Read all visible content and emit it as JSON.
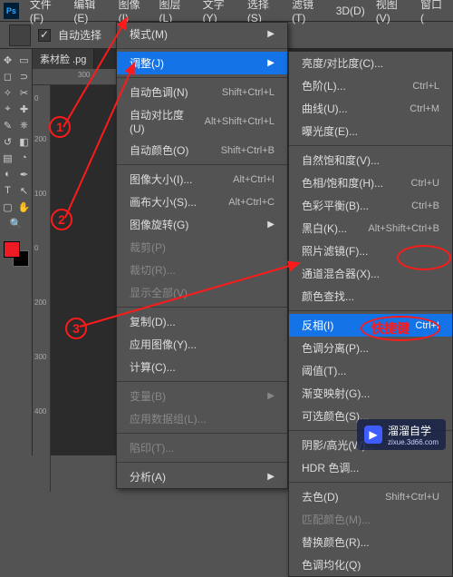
{
  "menubar": {
    "items": [
      "文件(F)",
      "编辑(E)",
      "图像(I)",
      "图层(L)",
      "文字(Y)",
      "选择(S)",
      "滤镜(T)",
      "3D(D)",
      "视图(V)",
      "窗口("
    ]
  },
  "options": {
    "auto_select": "自动选择"
  },
  "doc": {
    "tab": "素材脸 .pg",
    "ruler_h": [
      "300"
    ],
    "ruler_v": [
      "0",
      "200",
      "100",
      "0",
      "200",
      "300",
      "400"
    ]
  },
  "image_menu": [
    {
      "label": "模式(M)",
      "arrow": true
    },
    {
      "sep": true
    },
    {
      "label": "调整(J)",
      "arrow": true,
      "hl": true
    },
    {
      "sep": true
    },
    {
      "label": "自动色调(N)",
      "sc": "Shift+Ctrl+L"
    },
    {
      "label": "自动对比度(U)",
      "sc": "Alt+Shift+Ctrl+L"
    },
    {
      "label": "自动颜色(O)",
      "sc": "Shift+Ctrl+B"
    },
    {
      "sep": true
    },
    {
      "label": "图像大小(I)...",
      "sc": "Alt+Ctrl+I"
    },
    {
      "label": "画布大小(S)...",
      "sc": "Alt+Ctrl+C"
    },
    {
      "label": "图像旋转(G)",
      "arrow": true
    },
    {
      "label": "裁剪(P)",
      "dis": true
    },
    {
      "label": "裁切(R)...",
      "dis": true
    },
    {
      "label": "显示全部(V)",
      "dis": true
    },
    {
      "sep": true
    },
    {
      "label": "复制(D)..."
    },
    {
      "label": "应用图像(Y)..."
    },
    {
      "label": "计算(C)..."
    },
    {
      "sep": true
    },
    {
      "label": "变量(B)",
      "arrow": true,
      "dis": true
    },
    {
      "label": "应用数据组(L)...",
      "dis": true
    },
    {
      "sep": true
    },
    {
      "label": "陷印(T)...",
      "dis": true
    },
    {
      "sep": true
    },
    {
      "label": "分析(A)",
      "arrow": true
    }
  ],
  "adjust_menu": [
    {
      "label": "亮度/对比度(C)..."
    },
    {
      "label": "色阶(L)...",
      "sc": "Ctrl+L"
    },
    {
      "label": "曲线(U)...",
      "sc": "Ctrl+M"
    },
    {
      "label": "曝光度(E)..."
    },
    {
      "sep": true
    },
    {
      "label": "自然饱和度(V)..."
    },
    {
      "label": "色相/饱和度(H)...",
      "sc": "Ctrl+U"
    },
    {
      "label": "色彩平衡(B)...",
      "sc": "Ctrl+B"
    },
    {
      "label": "黑白(K)...",
      "sc": "Alt+Shift+Ctrl+B"
    },
    {
      "label": "照片滤镜(F)..."
    },
    {
      "label": "通道混合器(X)..."
    },
    {
      "label": "颜色查找..."
    },
    {
      "sep": true
    },
    {
      "label": "反相(I)",
      "sc": "Ctrl+I",
      "hl": true
    },
    {
      "label": "色调分离(P)..."
    },
    {
      "label": "阈值(T)..."
    },
    {
      "label": "渐变映射(G)..."
    },
    {
      "label": "可选颜色(S)..."
    },
    {
      "sep": true
    },
    {
      "label": "阴影/高光(W)..."
    },
    {
      "label": "HDR 色调..."
    },
    {
      "sep": true
    },
    {
      "label": "去色(D)",
      "sc": "Shift+Ctrl+U"
    },
    {
      "label": "匹配颜色(M)...",
      "dis": true
    },
    {
      "label": "替换颜色(R)..."
    },
    {
      "label": "色调均化(Q)"
    }
  ],
  "annotations": {
    "n1": "1",
    "n2": "2",
    "n3": "3",
    "shortcut_label": "快捷键"
  },
  "watermark": {
    "brand": "溜溜自学",
    "url": "zixue.3d66.com"
  }
}
